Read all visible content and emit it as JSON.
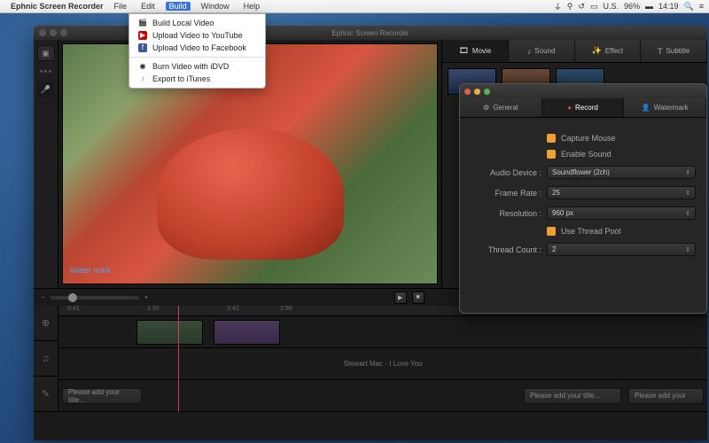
{
  "menubar": {
    "app": "Ephnic Screen Recorder",
    "items": [
      "File",
      "Edit",
      "Build",
      "Window",
      "Help"
    ],
    "active_index": 2,
    "right": {
      "flag": "U.S.",
      "battery": "96%",
      "time": "14:19"
    }
  },
  "dropdown": {
    "items": [
      {
        "icon": "🎬",
        "label": "Build Local Video"
      },
      {
        "icon": "▶",
        "label": "Upload Video to YouTube"
      },
      {
        "icon": "f",
        "label": "Upload Video to Facebook"
      },
      {
        "sep": true
      },
      {
        "icon": "◉",
        "label": "Burn Video with iDVD"
      },
      {
        "icon": "♪",
        "label": "Export to iTunes"
      }
    ]
  },
  "window": {
    "title": "Ephnic Screen Recorder"
  },
  "preview": {
    "watermark": "Water mark"
  },
  "tabs": [
    {
      "icon": "🎞",
      "label": "Movie",
      "active": true
    },
    {
      "icon": "♪",
      "label": "Sound"
    },
    {
      "icon": "✨",
      "label": "Effect"
    },
    {
      "icon": "T",
      "label": "Subtitle"
    }
  ],
  "settings": {
    "tabs": [
      {
        "icon": "⚙",
        "label": "General"
      },
      {
        "icon": "●",
        "label": "Record",
        "active": true
      },
      {
        "icon": "👤",
        "label": "Watermark"
      }
    ],
    "capture_mouse": {
      "label": "Capture Mouse",
      "checked": true
    },
    "enable_sound": {
      "label": "Enable Sound",
      "checked": true
    },
    "audio_device": {
      "label": "Audio Device :",
      "value": "Soundflower (2ch)"
    },
    "frame_rate": {
      "label": "Frame Rate :",
      "value": "25"
    },
    "resolution": {
      "label": "Resolution :",
      "value": "960 px"
    },
    "use_thread_pool": {
      "label": "Use Thread Pool",
      "checked": true
    },
    "thread_count": {
      "label": "Thread Count :",
      "value": "2"
    }
  },
  "timeline": {
    "ticks": [
      "0:41",
      "1:30",
      "2:42",
      "2:55"
    ],
    "audio_title": "Stewart Mac - I Love You",
    "title_placeholder": "Please add your title...",
    "title_placeholder2": "Please add your"
  }
}
